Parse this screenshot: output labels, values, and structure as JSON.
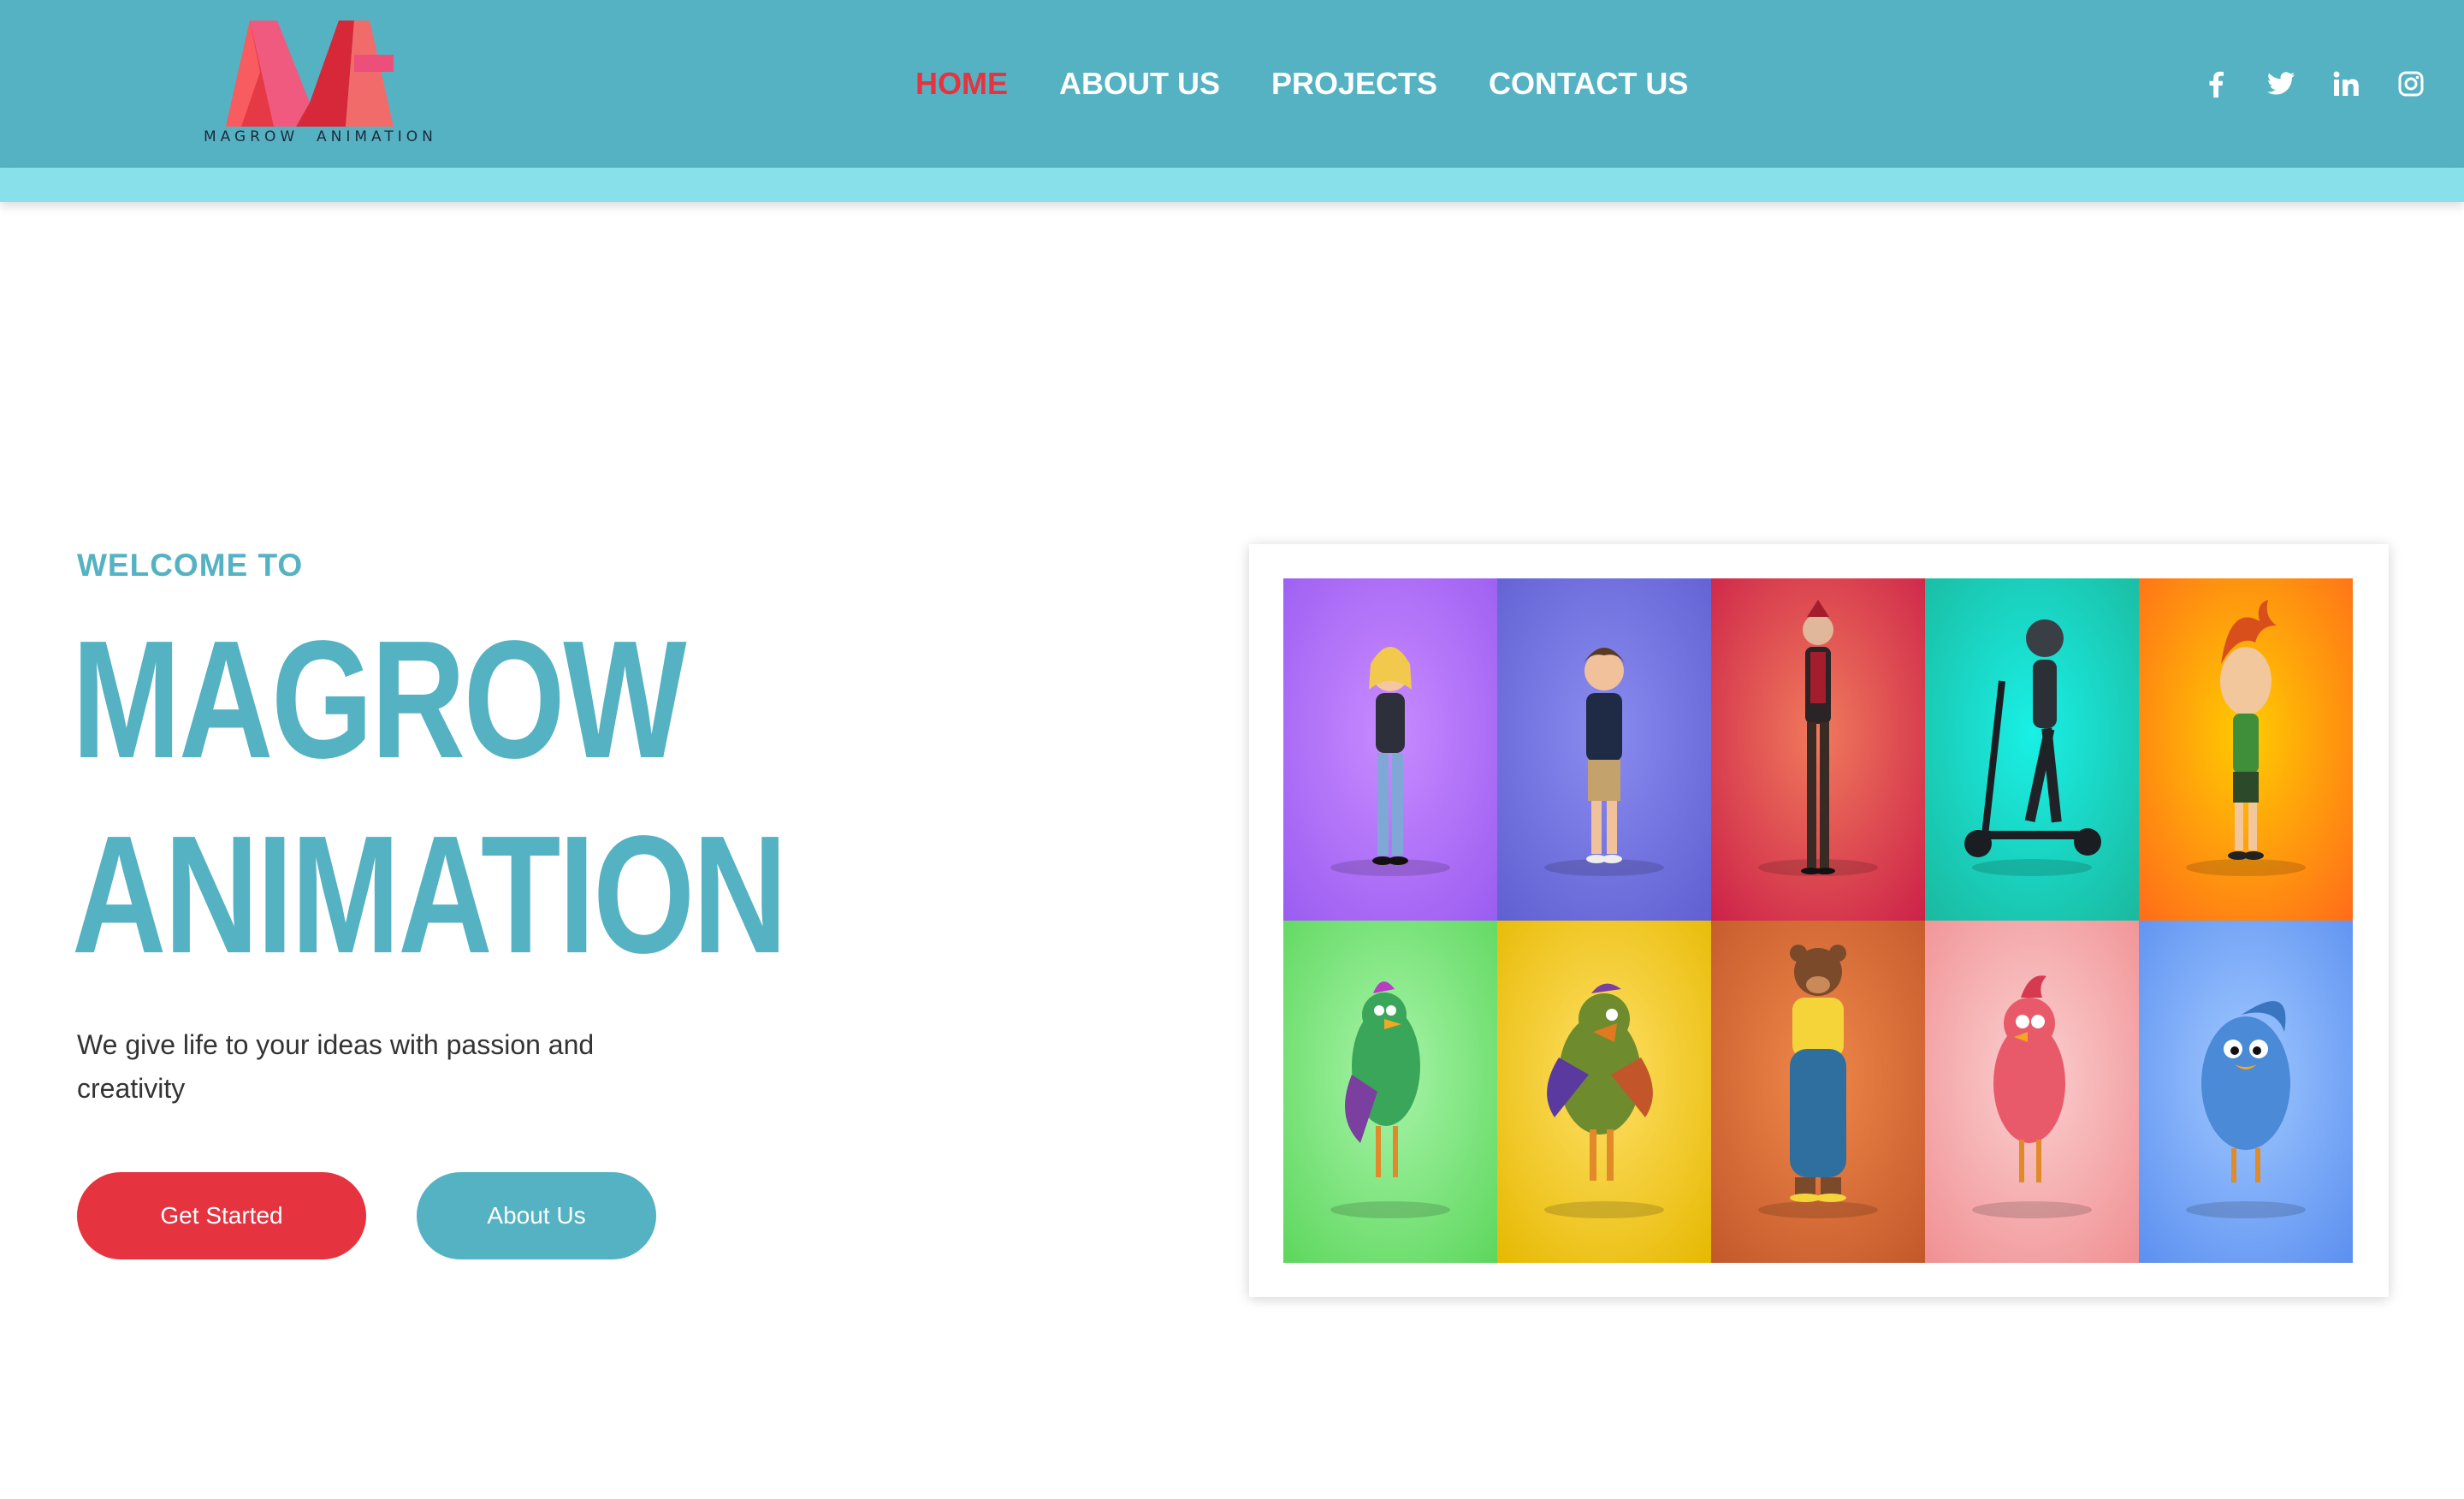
{
  "brand": {
    "logo_text": "MAGROW  ANIMATION",
    "colors": {
      "primary": "#55b2c2",
      "accent": "#e5333f",
      "stripe": "#88e0eb"
    }
  },
  "nav": {
    "items": [
      {
        "label": "HOME",
        "active": true
      },
      {
        "label": "ABOUT US",
        "active": false
      },
      {
        "label": "PROJECTS",
        "active": false
      },
      {
        "label": "CONTACT US",
        "active": false
      }
    ]
  },
  "social": {
    "icons": [
      "facebook-icon",
      "twitter-icon",
      "linkedin-icon",
      "instagram-icon"
    ]
  },
  "hero": {
    "eyebrow": "WELCOME TO",
    "title_line1": "MAGROW",
    "title_line2": "ANIMATION",
    "subtitle": "We give life to your ideas with passion and creativity",
    "primary_button": "Get Started",
    "secondary_button": "About Us"
  },
  "gallery": {
    "tiles": [
      {
        "character": "girl-character",
        "bg_top": "#c98bff",
        "bg_bottom": "#9a5cf0"
      },
      {
        "character": "boy-character",
        "bg_top": "#8a8cf0",
        "bg_bottom": "#5f5fd1"
      },
      {
        "character": "villain-character",
        "bg_top": "#f07a5c",
        "bg_bottom": "#cc2048"
      },
      {
        "character": "scooter-rider-character",
        "bg_top": "#19f0e6",
        "bg_bottom": "#1bb89d"
      },
      {
        "character": "redhead-boy-character",
        "bg_top": "#ffcc00",
        "bg_bottom": "#ff6b1a"
      },
      {
        "character": "green-bird-character",
        "bg_top": "#a8f5a8",
        "bg_bottom": "#5cd65c"
      },
      {
        "character": "parrot-character",
        "bg_top": "#ffe066",
        "bg_bottom": "#e6b800"
      },
      {
        "character": "bear-character",
        "bg_top": "#f0884a",
        "bg_bottom": "#c2582a"
      },
      {
        "character": "pink-bird-character",
        "bg_top": "#fbd0d0",
        "bg_bottom": "#f08f92"
      },
      {
        "character": "blue-bird-character",
        "bg_top": "#a0c8ff",
        "bg_bottom": "#5b8ff0"
      }
    ]
  }
}
